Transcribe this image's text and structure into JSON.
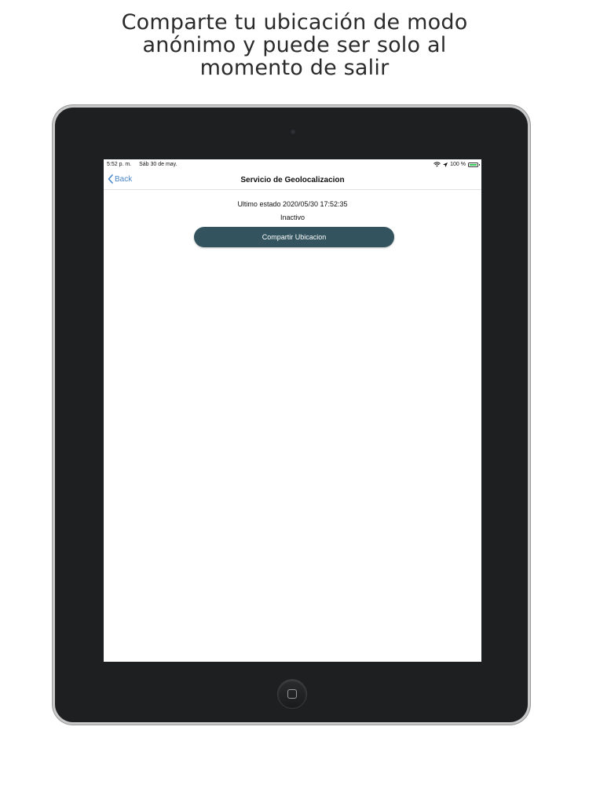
{
  "headline": {
    "line1": "Comparte tu ubicación de modo",
    "line2": "anónimo y puede ser solo al",
    "line3": "momento de salir"
  },
  "status_bar": {
    "time": "5:52 p. m.",
    "date": "Sáb 30 de may.",
    "battery_percent": "100 %",
    "icons": [
      "wifi-icon",
      "location-arrow-icon",
      "battery-icon"
    ],
    "battery_color": "#34c759"
  },
  "nav": {
    "back_label": "Back",
    "title": "Servicio de Geolocalizacion"
  },
  "content": {
    "last_state": "Ultimo estado 2020/05/30 17:52:35",
    "state": "Inactivo",
    "share_button_label": "Compartir Ubicacion"
  },
  "colors": {
    "button_bg": "#33545f",
    "link": "#4a86c8",
    "device_bezel": "#1d1f21"
  }
}
